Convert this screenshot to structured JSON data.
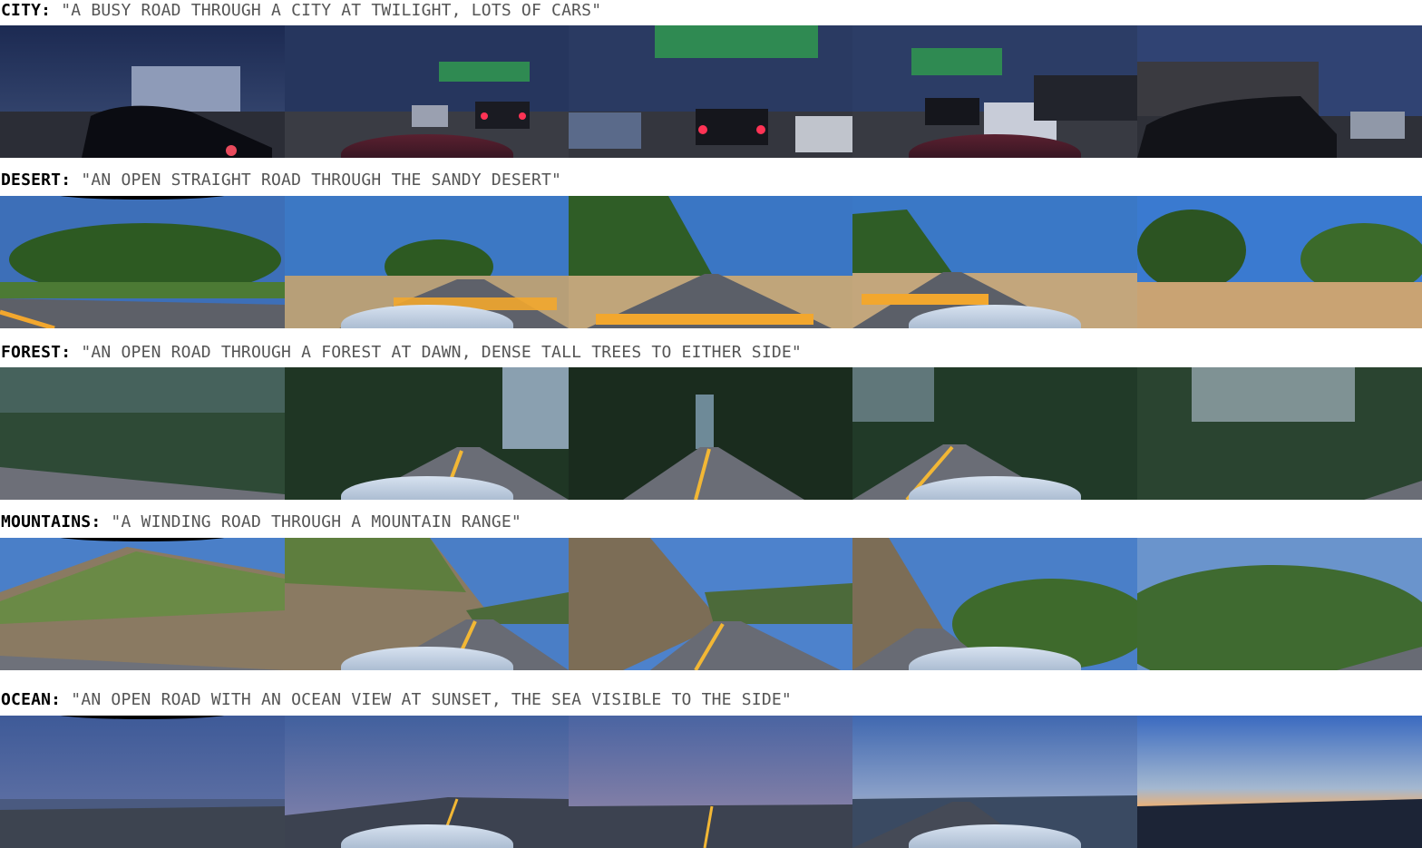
{
  "rows": [
    {
      "name": "CITY:",
      "prompt": "\"A BUSY ROAD THROUGH A CITY AT TWILIGHT, LOTS OF CARS\""
    },
    {
      "name": "DESERT:",
      "prompt": "\"AN OPEN STRAIGHT ROAD THROUGH THE SANDY DESERT\""
    },
    {
      "name": "FOREST:",
      "prompt": "\"AN OPEN ROAD THROUGH A FOREST AT DAWN, DENSE TALL TREES TO EITHER SIDE\""
    },
    {
      "name": "MOUNTAINS:",
      "prompt": "\"A WINDING ROAD THROUGH A MOUNTAIN RANGE\""
    },
    {
      "name": "OCEAN:",
      "prompt": "\"AN OPEN ROAD WITH AN OCEAN VIEW AT SUNSET, THE SEA VISIBLE TO THE SIDE\""
    }
  ]
}
